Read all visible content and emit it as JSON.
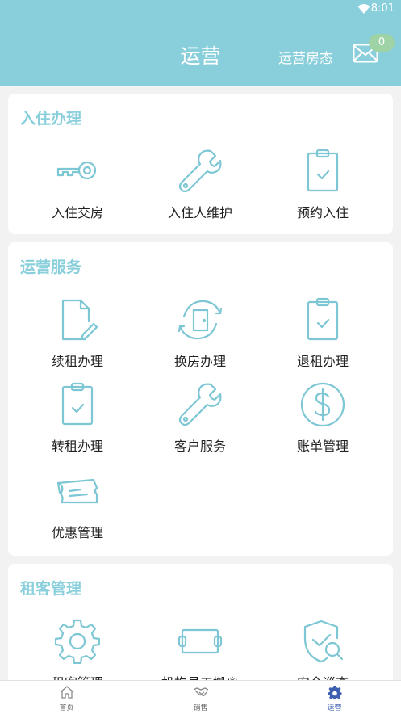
{
  "status_bar": {
    "time": "8:01"
  },
  "header": {
    "title": "运营",
    "room_status": "运营房态",
    "badge_count": "0"
  },
  "sections": [
    {
      "title": "入住办理",
      "items": [
        {
          "label": "入住交房",
          "icon": "key-icon"
        },
        {
          "label": "入住人维护",
          "icon": "wrench-icon"
        },
        {
          "label": "预约入住",
          "icon": "clipboard-check-icon"
        }
      ]
    },
    {
      "title": "运营服务",
      "items": [
        {
          "label": "续租办理",
          "icon": "document-pen-icon"
        },
        {
          "label": "换房办理",
          "icon": "door-refresh-icon"
        },
        {
          "label": "退租办理",
          "icon": "clipboard-check-icon"
        },
        {
          "label": "转租办理",
          "icon": "clipboard-check-icon"
        },
        {
          "label": "客户服务",
          "icon": "wrench-icon"
        },
        {
          "label": "账单管理",
          "icon": "dollar-circle-icon"
        },
        {
          "label": "优惠管理",
          "icon": "ticket-icon"
        }
      ]
    },
    {
      "title": "租客管理",
      "items": [
        {
          "label": "租客管理",
          "icon": "gear-icon"
        },
        {
          "label": "机构员工搬离",
          "icon": "ticket-box-icon"
        },
        {
          "label": "安全巡查",
          "icon": "shield-search-icon"
        }
      ]
    }
  ],
  "tabbar": [
    {
      "label": "首页",
      "icon": "home-icon"
    },
    {
      "label": "销售",
      "icon": "handshake-icon"
    },
    {
      "label": "运营",
      "icon": "gear-icon",
      "active": true
    }
  ],
  "colors": {
    "primary": "#89cfdb",
    "icon_stroke": "#7dc6d4",
    "badge": "#9ed3a6",
    "active_tab": "#3f5fb0"
  }
}
